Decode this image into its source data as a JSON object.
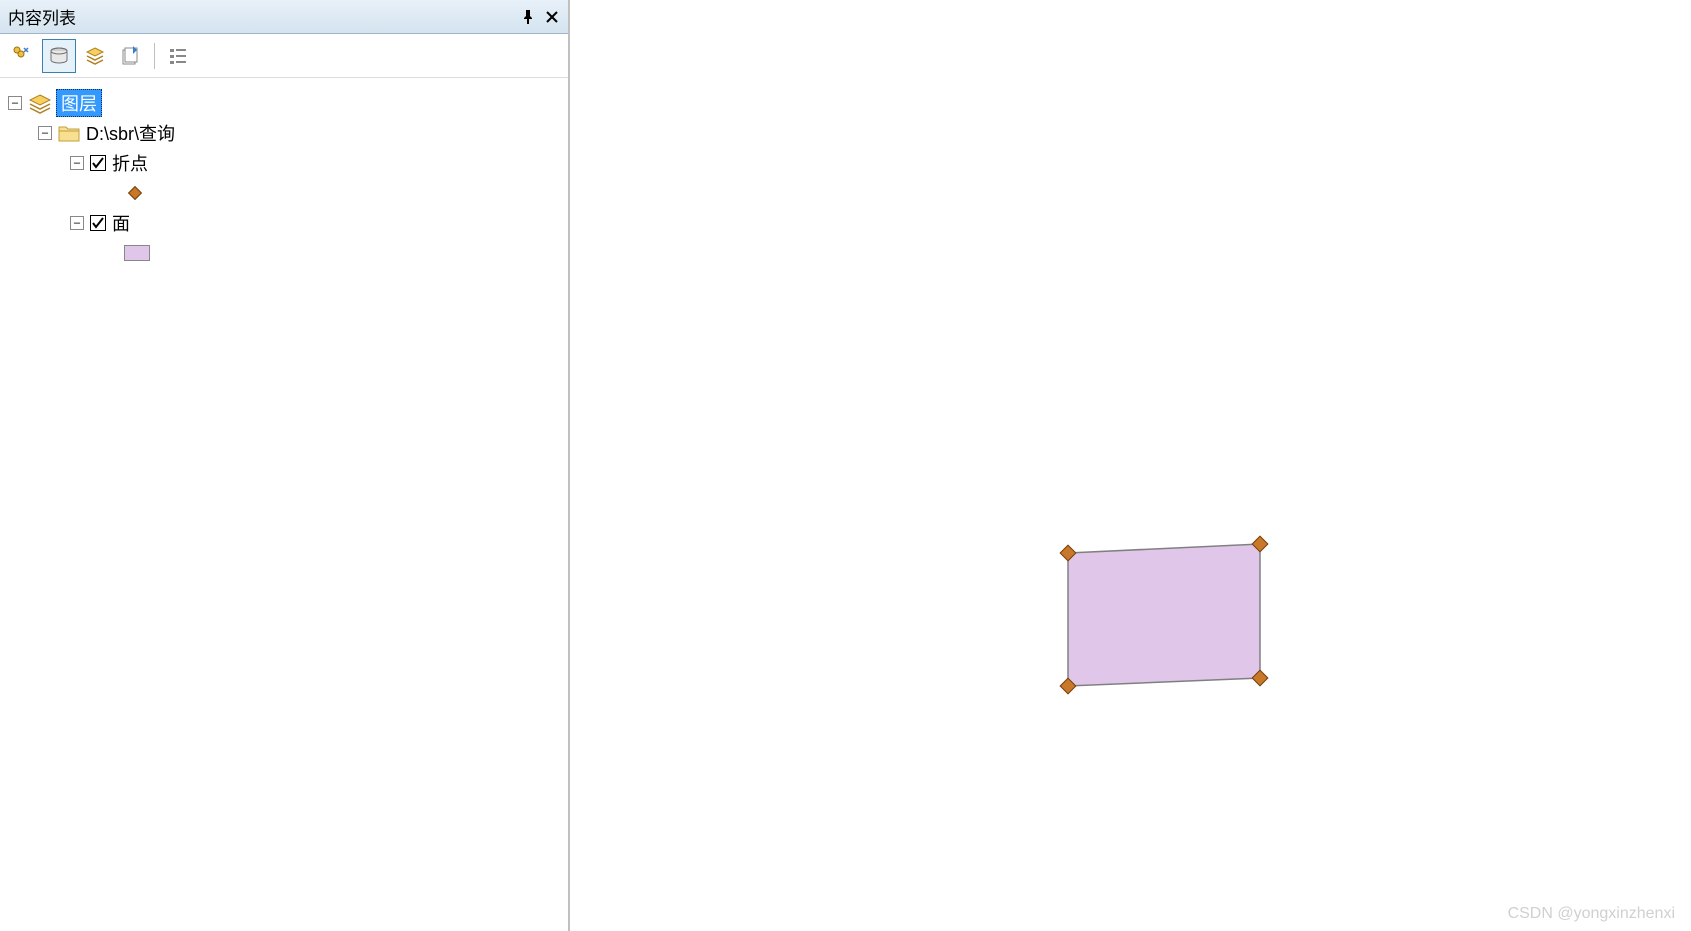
{
  "panel": {
    "title": "内容列表"
  },
  "tree": {
    "root_label": "图层",
    "folder_path": "D:\\sbr\\查询",
    "layers": {
      "points": {
        "label": "折点"
      },
      "polygon": {
        "label": "面"
      }
    }
  },
  "watermark": "CSDN @yongxinzhenxi"
}
